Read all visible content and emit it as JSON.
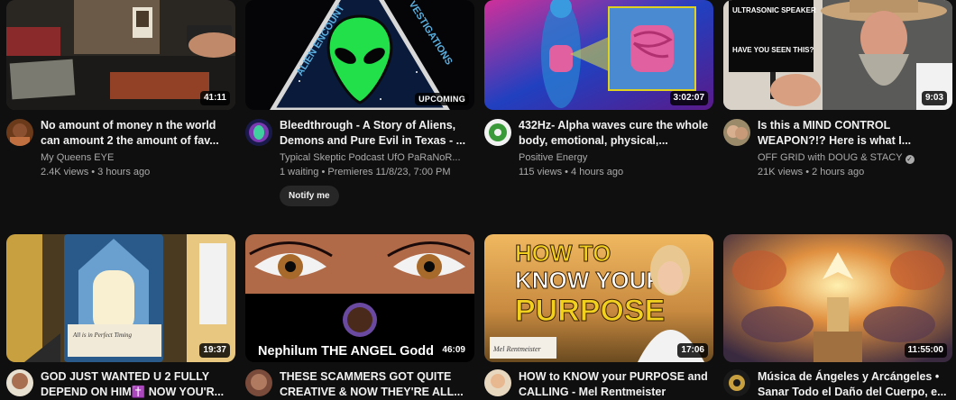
{
  "videos": [
    {
      "title": "No amount of money n the world can amount 2 the amount of fav...",
      "channel": "My Queens EYE",
      "stats": "2.4K views • 3 hours ago",
      "duration": "41:11",
      "verified": false
    },
    {
      "title": "Bleedthrough - A Story of Aliens, Demons and Pure Evil in Texas - ...",
      "channel": "Typical Skeptic Podcast UfO PaRaNoR...",
      "stats": "1 waiting • Premieres 11/8/23, 7:00 PM",
      "badge": "UPCOMING",
      "notify_label": "Notify me",
      "thumb_text_left": "ALIEN ENCOUNT",
      "thumb_text_right": "VESTIGATIONS"
    },
    {
      "title": "432Hz- Alpha waves cure the whole body, emotional, physical,...",
      "channel": "Positive Energy",
      "stats": "115 views • 4 hours ago",
      "duration": "3:02:07"
    },
    {
      "title": "Is this a MIND CONTROL WEAPON?!? Here is what I...",
      "channel": "OFF GRID with DOUG & STACY",
      "verified": true,
      "verified_glyph": "✓",
      "stats": "21K views • 2 hours ago",
      "duration": "9:03",
      "thumb_sign_1": "ULTRASONIC SPEAKER",
      "thumb_sign_2": "HAVE YOU SEEN THIS?"
    },
    {
      "title": "GOD JUST WANTED U 2 FULLY DEPEND ON HIM✝️ NOW YOU'R...",
      "channel": "",
      "stats": "",
      "duration": "19:37",
      "thumb_card_text": "All is in Perfect Timing"
    },
    {
      "title": "THESE SCAMMERS GOT QUITE CREATIVE & NOW THEY'RE ALL...",
      "channel": "",
      "stats": "",
      "duration": "46:09",
      "thumb_overlay_title": "Nephilum THE ANGEL Godd"
    },
    {
      "title": "HOW to KNOW your PURPOSE and CALLING - Mel Rentmeister",
      "channel": "",
      "stats": "",
      "duration": "17:06",
      "thumb_line_1": "HOW TO",
      "thumb_line_2": "KNOW YOUR",
      "thumb_line_3": "PURPOSE",
      "thumb_signature": "Mel Rentmeister"
    },
    {
      "title": "Música de Ángeles y Arcángeles • Sanar Todo el Daño del Cuerpo, e...",
      "channel": "",
      "stats": "",
      "duration": "11:55:00"
    }
  ]
}
